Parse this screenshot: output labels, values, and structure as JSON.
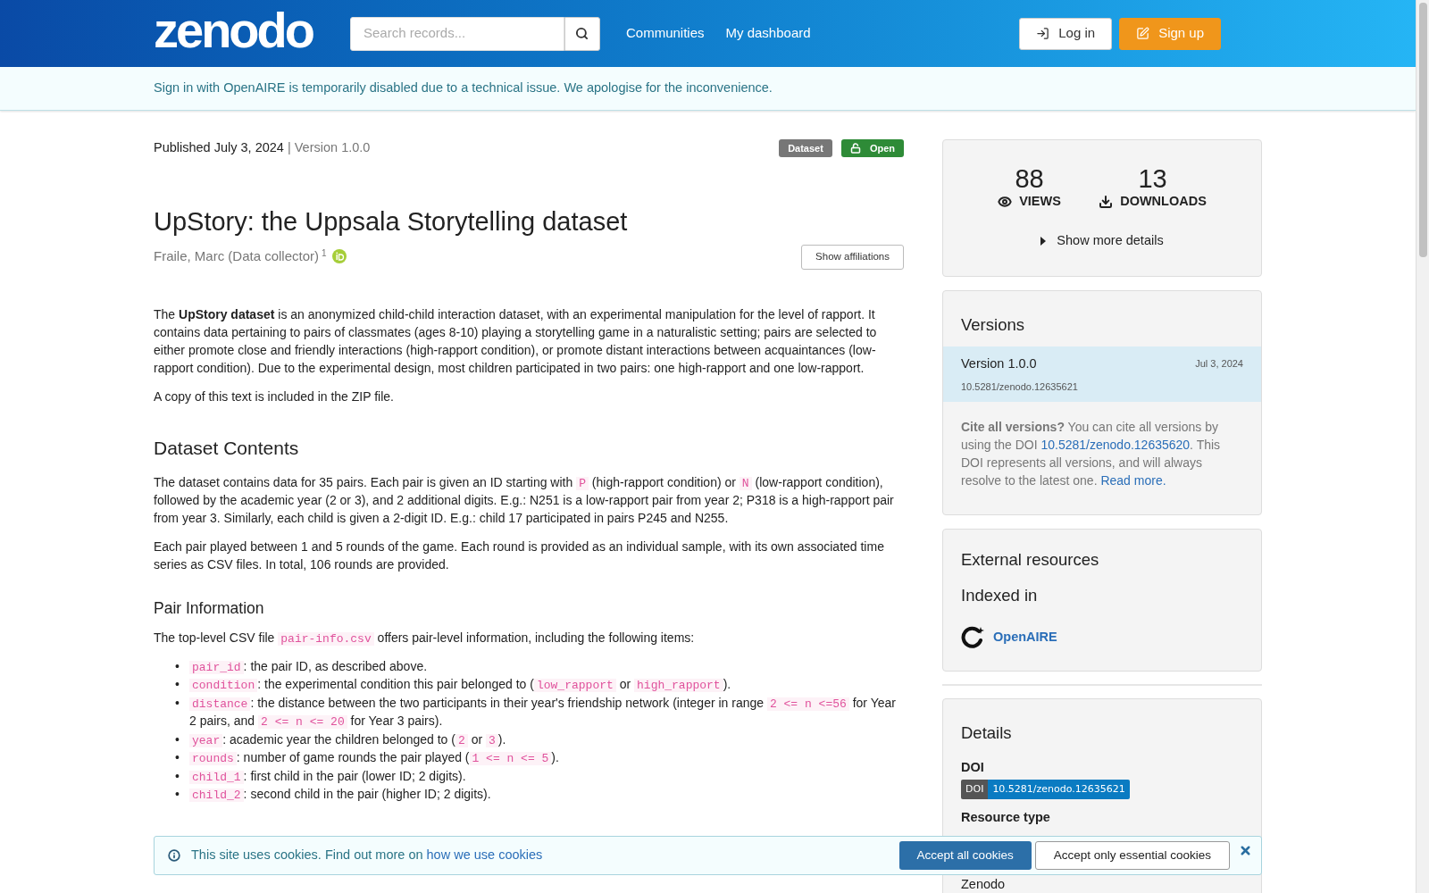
{
  "header": {
    "logo": "zenodo",
    "search": {
      "placeholder": "Search records..."
    },
    "nav": [
      "Communities",
      "My dashboard"
    ],
    "buttons": [
      {
        "label": "Log in",
        "kind": "login"
      },
      {
        "label": "Sign up",
        "kind": "signup"
      }
    ]
  },
  "alert": "Sign in with OpenAIRE is temporarily disabled due to a technical issue. We apologise for the inconvenience.",
  "record": {
    "published": "Published July 3, 2024",
    "version": "| Version 1.0.0",
    "badges": [
      {
        "label": "Dataset",
        "kind": "type"
      },
      {
        "label": "Open",
        "kind": "access"
      }
    ],
    "title": "UpStory: the Uppsala Storytelling dataset",
    "creators": [
      {
        "name": "Fraile, Marc (Data collector)",
        "affiliation": "1"
      }
    ],
    "affiliations_button": "Show affiliations"
  },
  "description": [
    {
      "kind": "p",
      "segments": [
        {
          "kind": "text",
          "text": "The "
        },
        {
          "kind": "bold",
          "text": "UpStory dataset"
        },
        {
          "kind": "text",
          "text": " is an anonymized child-child interaction dataset, with an experimental manipulation for the level of rapport. It contains data pertaining to pairs of classmates (ages 8-10) playing a storytelling game in a naturalistic setting; pairs are selected to either promote close and friendly interactions (high-rapport condition), or promote distant interactions between acquaintances (low-rapport condition). Due to the experimental design, most children participated in two pairs: one high-rapport and one low-rapport."
        }
      ]
    },
    {
      "kind": "p",
      "segments": [
        {
          "kind": "text",
          "text": "A copy of this text is included in the ZIP file."
        }
      ]
    },
    {
      "kind": "h2",
      "text": "Dataset Contents"
    },
    {
      "kind": "p",
      "segments": [
        {
          "kind": "text",
          "text": "The dataset contains data for 35 pairs. Each pair is given an ID starting with "
        },
        {
          "kind": "code",
          "text": "P"
        },
        {
          "kind": "text",
          "text": " (high-rapport condition) or "
        },
        {
          "kind": "code",
          "text": "N"
        },
        {
          "kind": "text",
          "text": " (low-rapport condition), followed by the academic year (2 or 3), and 2 additional digits. E.g.: N251 is a low-rapport pair from year 2; P318 is a high-rapport pair from year 3. Similarly, each child is given a 2-digit ID. E.g.: child 17 participated in pairs P245 and N255."
        }
      ]
    },
    {
      "kind": "p",
      "segments": [
        {
          "kind": "text",
          "text": "Each pair played between 1 and 5 rounds of the game. Each round is provided as an individual sample, with its own associated time series as CSV files. In total, 106 rounds are provided."
        }
      ]
    },
    {
      "kind": "h3",
      "text": "Pair Information"
    },
    {
      "kind": "p",
      "segments": [
        {
          "kind": "text",
          "text": "The top-level CSV file "
        },
        {
          "kind": "code",
          "text": "pair-info.csv"
        },
        {
          "kind": "text",
          "text": " offers pair-level information, including the following items:"
        }
      ]
    },
    {
      "kind": "list",
      "marker": "•",
      "items": [
        [
          {
            "kind": "code",
            "text": "pair_id"
          },
          {
            "kind": "text",
            "text": ": the pair ID, as described above."
          }
        ],
        [
          {
            "kind": "code",
            "text": "condition"
          },
          {
            "kind": "text",
            "text": ": the experimental condition this pair belonged to ("
          },
          {
            "kind": "code",
            "text": "low_rapport"
          },
          {
            "kind": "text",
            "text": " or "
          },
          {
            "kind": "code",
            "text": "high_rapport"
          },
          {
            "kind": "text",
            "text": ")."
          }
        ],
        [
          {
            "kind": "code",
            "text": "distance"
          },
          {
            "kind": "text",
            "text": ": the distance between the two participants in their year's friendship network (integer in range "
          },
          {
            "kind": "code",
            "text": "2 <= n <=56"
          },
          {
            "kind": "text",
            "text": " for Year 2 pairs, and "
          },
          {
            "kind": "code",
            "text": "2 <= n <= 20"
          },
          {
            "kind": "text",
            "text": " for Year 3 pairs)."
          }
        ],
        [
          {
            "kind": "code",
            "text": "year"
          },
          {
            "kind": "text",
            "text": ": academic year the children belonged to ("
          },
          {
            "kind": "code",
            "text": "2"
          },
          {
            "kind": "text",
            "text": " or "
          },
          {
            "kind": "code",
            "text": "3"
          },
          {
            "kind": "text",
            "text": ")."
          }
        ],
        [
          {
            "kind": "code",
            "text": "rounds"
          },
          {
            "kind": "text",
            "text": ": number of game rounds the pair played ("
          },
          {
            "kind": "code",
            "text": "1 <= n <= 5"
          },
          {
            "kind": "text",
            "text": ")."
          }
        ],
        [
          {
            "kind": "code",
            "text": "child_1"
          },
          {
            "kind": "text",
            "text": ": first child in the pair (lower ID; 2 digits)."
          }
        ],
        [
          {
            "kind": "code",
            "text": "child_2"
          },
          {
            "kind": "text",
            "text": ": second child in the pair (higher ID; 2 digits)."
          }
        ]
      ]
    }
  ],
  "sidebar": {
    "stats": [
      {
        "value": "88",
        "label": "VIEWS",
        "kind": "views"
      },
      {
        "value": "13",
        "label": "DOWNLOADS",
        "kind": "downloads"
      }
    ],
    "more_details": "Show more details",
    "versions": {
      "title": "Versions",
      "items": [
        {
          "version": "Version 1.0.0",
          "date": "Jul 3, 2024",
          "doi": "10.5281/zenodo.12635621",
          "selected": true
        }
      ],
      "cite": [
        {
          "kind": "bold",
          "text": "Cite all versions?"
        },
        {
          "kind": "text",
          "text": " You can cite all versions by using the DOI "
        },
        {
          "kind": "link",
          "text": "10.5281/zenodo.12635620"
        },
        {
          "kind": "text",
          "text": ". This DOI represents all versions, and will always resolve to the latest one. "
        },
        {
          "kind": "link",
          "text": "Read more."
        }
      ]
    },
    "external": {
      "title": "External resources",
      "subtitle": "Indexed in",
      "links": [
        "OpenAIRE"
      ]
    },
    "details": {
      "title": "Details",
      "doi_label": "DOI",
      "doi_badge": "DOI",
      "doi": "10.5281/zenodo.12635621",
      "resource_type_label": "Resource type",
      "publisher": "Zenodo"
    }
  },
  "cookie_banner": {
    "text": "This site uses cookies. Find out more on ",
    "link": "how we use cookies",
    "accept_all": "Accept all cookies",
    "accept_essential": "Accept only essential cookies"
  }
}
